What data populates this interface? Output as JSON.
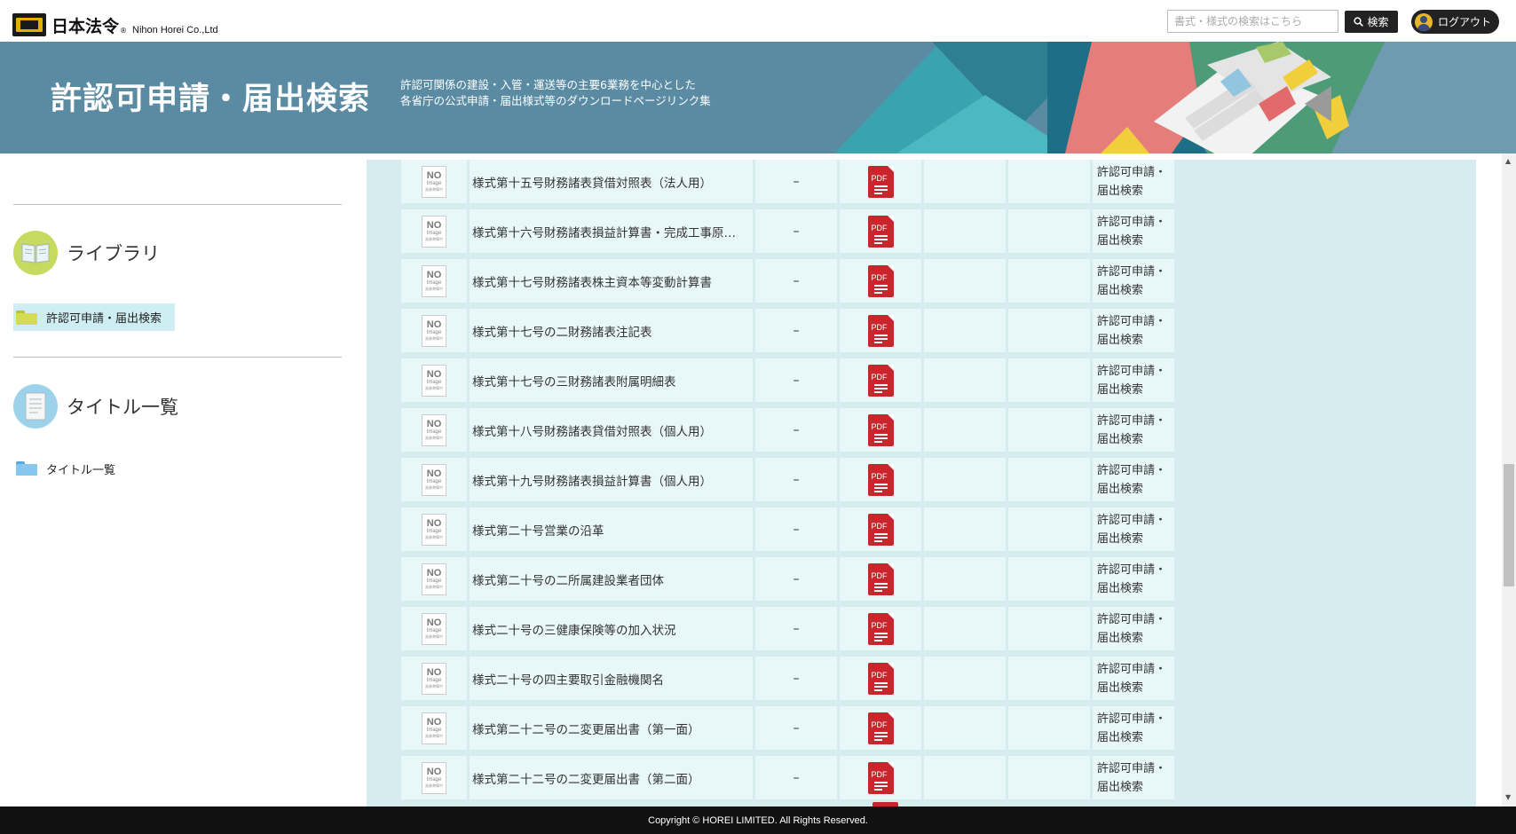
{
  "header": {
    "logo_jp": "日本法令",
    "logo_registered": "®",
    "logo_en": "Nihon Horei Co.,Ltd",
    "search_placeholder": "書式・様式の検索はこちら",
    "search_button": "検索",
    "logout_button": "ログアウト"
  },
  "banner": {
    "title": "許認可申請・届出検索",
    "subtitle_line1": "許認可関係の建設・入管・運送等の主要6業務を中心とした",
    "subtitle_line2": "各省庁の公式申請・届出様式等のダウンロードページリンク集"
  },
  "sidebar": {
    "library_heading": "ライブラリ",
    "library_item": "許認可申請・届出検索",
    "titles_heading": "タイトル一覧",
    "titles_item": "タイトル一覧"
  },
  "table": {
    "rows": [
      {
        "title": "様式第十五号財務諸表貸借対照表（法人用）",
        "dash": "–",
        "pdf": "PDF",
        "category": "許認可申請・届出検索"
      },
      {
        "title": "様式第十六号財務諸表損益計算書・完成工事原…",
        "dash": "–",
        "pdf": "PDF",
        "category": "許認可申請・届出検索"
      },
      {
        "title": "様式第十七号財務諸表株主資本等変動計算書",
        "dash": "–",
        "pdf": "PDF",
        "category": "許認可申請・届出検索"
      },
      {
        "title": "様式第十七号の二財務諸表注記表",
        "dash": "–",
        "pdf": "PDF",
        "category": "許認可申請・届出検索"
      },
      {
        "title": "様式第十七号の三財務諸表附属明細表",
        "dash": "–",
        "pdf": "PDF",
        "category": "許認可申請・届出検索"
      },
      {
        "title": "様式第十八号財務諸表貸借対照表（個人用）",
        "dash": "–",
        "pdf": "PDF",
        "category": "許認可申請・届出検索"
      },
      {
        "title": "様式第十九号財務諸表損益計算書（個人用）",
        "dash": "–",
        "pdf": "PDF",
        "category": "許認可申請・届出検索"
      },
      {
        "title": "様式第二十号営業の沿革",
        "dash": "–",
        "pdf": "PDF",
        "category": "許認可申請・届出検索"
      },
      {
        "title": "様式第二十号の二所属建設業者団体",
        "dash": "–",
        "pdf": "PDF",
        "category": "許認可申請・届出検索"
      },
      {
        "title": "様式二十号の三健康保険等の加入状況",
        "dash": "–",
        "pdf": "PDF",
        "category": "許認可申請・届出検索"
      },
      {
        "title": "様式二十号の四主要取引金融機関名",
        "dash": "–",
        "pdf": "PDF",
        "category": "許認可申請・届出検索"
      },
      {
        "title": "様式第二十二号の二変更届出書（第一面）",
        "dash": "–",
        "pdf": "PDF",
        "category": "許認可申請・届出検索"
      },
      {
        "title": "様式第二十二号の二変更届出書（第二面）",
        "dash": "–",
        "pdf": "PDF",
        "category": "許認可申請・届出検索"
      }
    ],
    "noimage_text": "NO",
    "noimage_sub": "Image",
    "noimage_small": "画像準備中"
  },
  "footer": {
    "copyright": "Copyright © HOREI LIMITED. All Rights Reserved."
  },
  "colors": {
    "banner_bg": "#5a8ba3",
    "row_bg": "#e8f7f8",
    "table_bg": "#d7ecef",
    "pdf_red": "#c9252c",
    "footer_bg": "#111111"
  }
}
